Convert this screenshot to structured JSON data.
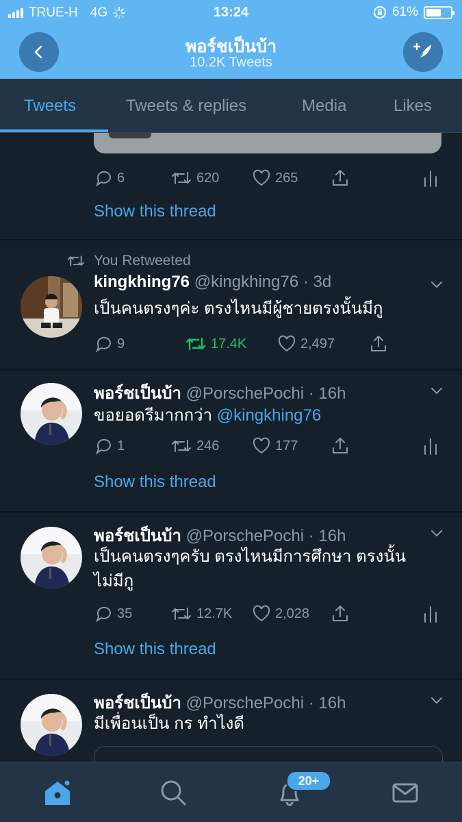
{
  "status_bar": {
    "carrier": "TRUE-H",
    "network": "4G",
    "time": "13:24",
    "battery": "61%",
    "battery_level": 0.61
  },
  "header": {
    "title": "พอร์ชเป็นบ้า",
    "subtitle": "10.2K Tweets"
  },
  "tabs": [
    {
      "label": "Tweets",
      "active": true
    },
    {
      "label": "Tweets & replies",
      "active": false
    },
    {
      "label": "Media",
      "active": false
    },
    {
      "label": "Likes",
      "active": false
    }
  ],
  "tweets": [
    {
      "partial": true,
      "actions": {
        "replies": "6",
        "retweets": "620",
        "likes": "265"
      },
      "show_thread": "Show this thread"
    },
    {
      "retweeted_label": "You Retweeted",
      "name": "kingkhing76",
      "handle": "@kingkhing76",
      "time": "· 3d",
      "text": "เป็นคนตรงๆค่ะ ตรงไหนมีผู้ชายตรงนั้นมีกู",
      "actions": {
        "replies": "9",
        "retweets": "17.4K",
        "likes": "2,497"
      },
      "retweeted_by_me": true
    },
    {
      "name": "พอร์ชเป็นบ้า",
      "handle": "@PorschePochi",
      "time": "· 16h",
      "text": "ขอยอดรีมากกว่า",
      "mention": "@kingkhing76",
      "actions": {
        "replies": "1",
        "retweets": "246",
        "likes": "177"
      },
      "show_thread": "Show this thread"
    },
    {
      "name": "พอร์ชเป็นบ้า",
      "handle": "@PorschePochi",
      "time": "· 16h",
      "text_line1": "เป็นคนตรงๆครับ ตรงไหนมีการศึกษา ตรงนั้น",
      "text_line2": "ไม่มีกู",
      "actions": {
        "replies": "35",
        "retweets": "12.7K",
        "likes": "2,028"
      },
      "show_thread": "Show this thread"
    },
    {
      "name": "พอร์ชเป็นบ้า",
      "handle": "@PorschePochi",
      "time": "· 16h",
      "text": "มีเพื่อนเป็น กร ทำไงดี"
    }
  ],
  "bottom_nav": {
    "items": [
      "home-icon",
      "search-icon",
      "bell-icon",
      "mail-icon"
    ],
    "notification_badge": "20+"
  },
  "colors": {
    "header_bg": "#5fb6f2",
    "background": "#15202b",
    "accent": "#4aa8e8",
    "retweet_green": "#17bf63",
    "muted": "#8899a6"
  }
}
